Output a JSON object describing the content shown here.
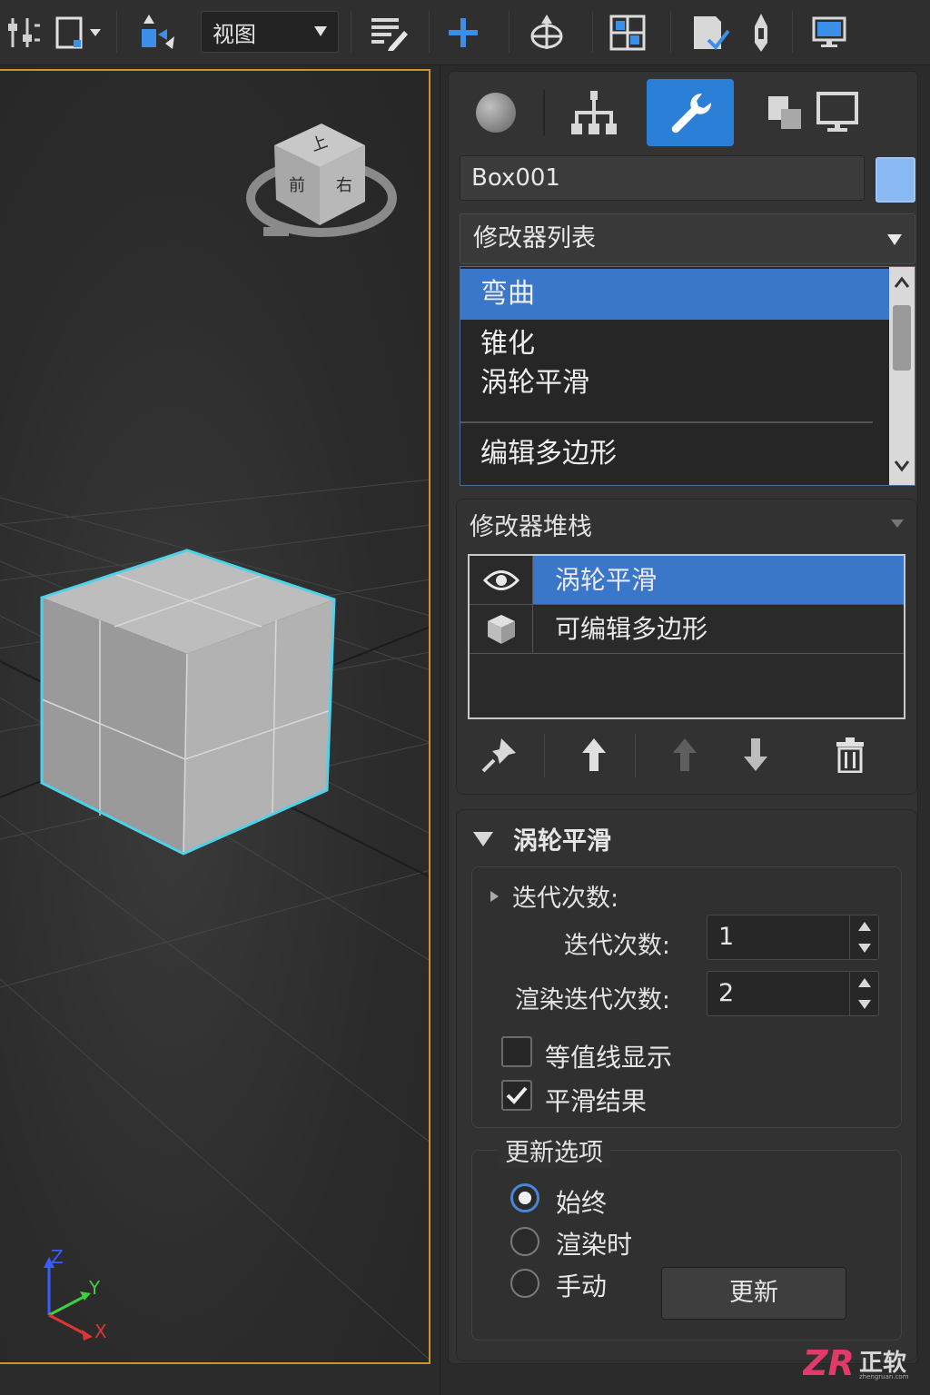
{
  "toolbar": {
    "view_dropdown": "视图",
    "icons": [
      "align-icon",
      "select-region-icon",
      "scale-icon",
      "view-dropdown",
      "layer-edit-icon",
      "create-plus-icon",
      "move-gizmo-icon",
      "schematic-icon",
      "material-check-icon",
      "render-pen-icon",
      "display-monitor-icon"
    ]
  },
  "viewport": {
    "viewcube": {
      "top": "上",
      "front": "前",
      "right": "右"
    },
    "axis": {
      "x": "X",
      "y": "Y",
      "z": "Z"
    },
    "selection_color": "#4fd2e8",
    "border_color": "#c8962a"
  },
  "command_panel": {
    "tabs": [
      "create-tab",
      "hierarchy-tab",
      "modify-tab",
      "motion-tab",
      "display-tab"
    ],
    "active_tab": "modify-tab",
    "active_color": "#2c7fd6",
    "object_name": "Box001",
    "object_color": "#8ab8f2",
    "modifier_list_label": "修改器列表",
    "modifier_dropdown": {
      "items": [
        "弯曲",
        "锥化",
        "涡轮平滑",
        "编辑多边形"
      ],
      "selected": "弯曲"
    },
    "modifier_stack": {
      "title": "修改器堆栈",
      "items": [
        {
          "icon": "eye-icon",
          "label": "涡轮平滑",
          "selected": true
        },
        {
          "icon": "cube-icon",
          "label": "可编辑多边形",
          "selected": false
        }
      ],
      "tools": [
        "pin-stack-icon",
        "move-up-icon",
        "move-up-disabled-icon",
        "move-down-icon",
        "delete-icon"
      ]
    },
    "turbosmooth": {
      "title": "涡轮平滑",
      "section": "迭代次数:",
      "iterations_label": "迭代次数:",
      "iterations": "1",
      "render_iterations_label": "渲染迭代次数:",
      "render_iterations": "2",
      "isoline_label": "等值线显示",
      "isoline_checked": false,
      "smooth_result_label": "平滑结果",
      "smooth_result_checked": true,
      "update_group": {
        "title": "更新选项",
        "options": [
          "始终",
          "渲染时",
          "手动"
        ],
        "selected": "始终",
        "update_button": "更新"
      }
    }
  },
  "watermark": {
    "logo": "ZR",
    "name": "正软",
    "url": "zhengruan.com"
  }
}
